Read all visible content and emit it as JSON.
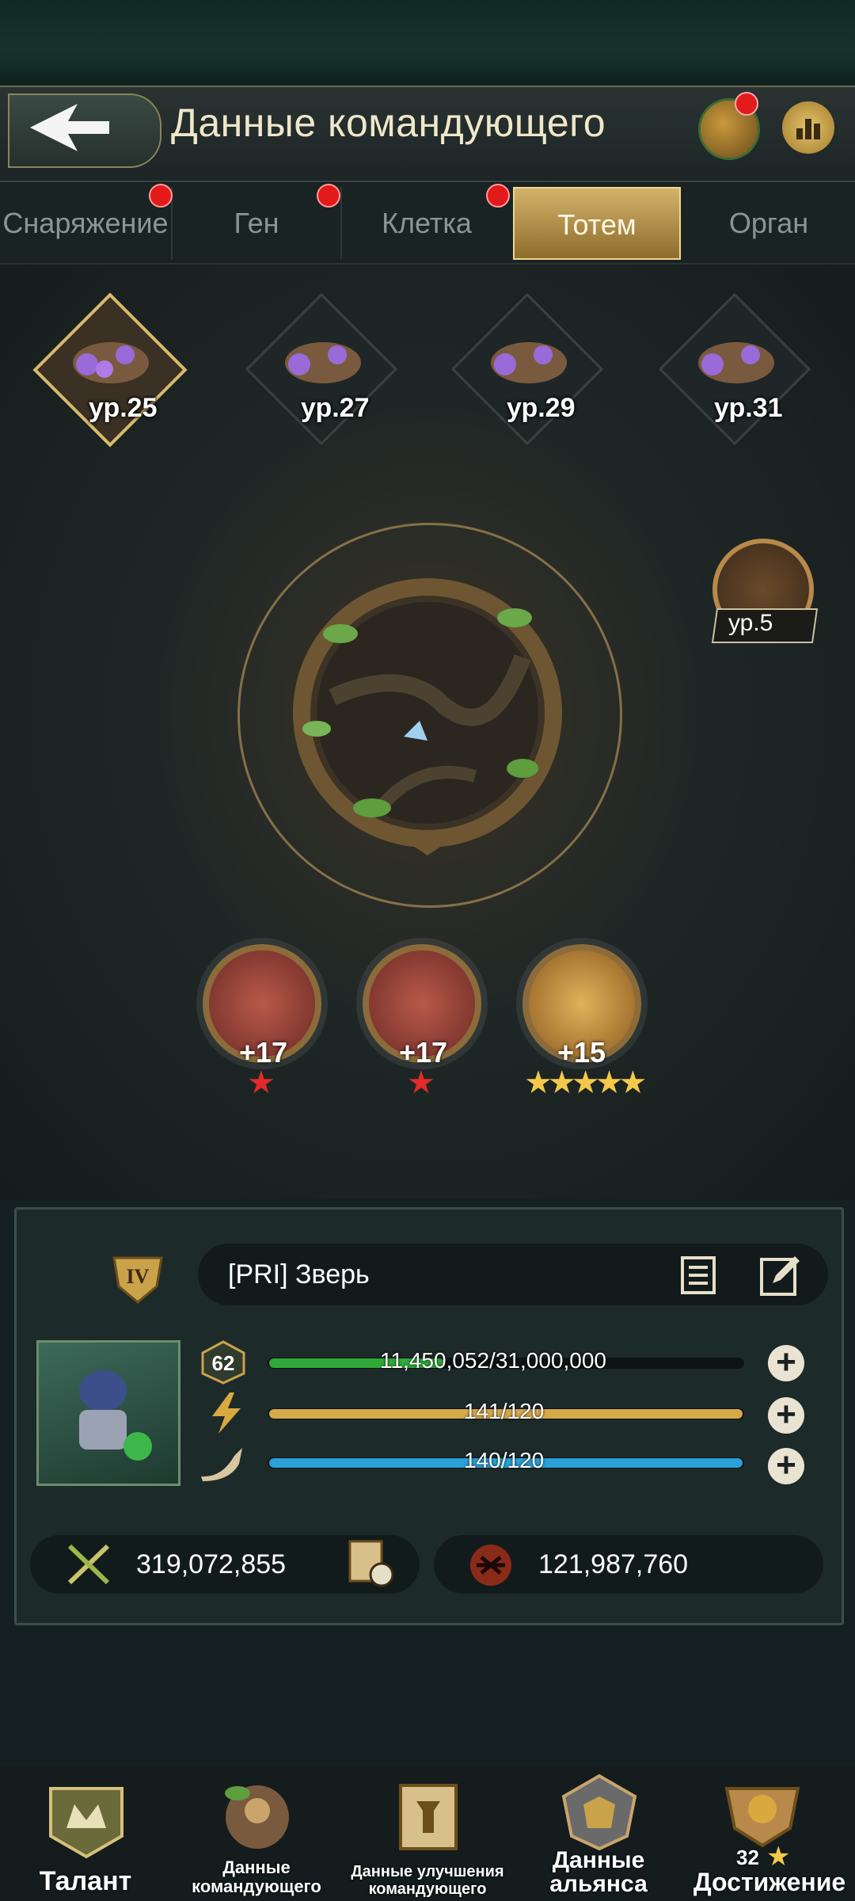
{
  "header": {
    "title": "Данные командующего",
    "back_label": "back"
  },
  "tabs": [
    {
      "label": "Снаряжение",
      "badge": true,
      "active": false
    },
    {
      "label": "Ген",
      "badge": true,
      "active": false
    },
    {
      "label": "Клетка",
      "badge": true,
      "active": false
    },
    {
      "label": "Тотем",
      "badge": false,
      "active": true
    },
    {
      "label": "Орган",
      "badge": false,
      "active": false
    }
  ],
  "totem_slots": [
    {
      "level": "ур.25",
      "selected": true
    },
    {
      "level": "ур.27",
      "selected": false
    },
    {
      "level": "ур.29",
      "selected": false
    },
    {
      "level": "ур.31",
      "selected": false
    }
  ],
  "side_emblem": {
    "level": "ур.5"
  },
  "medals": [
    {
      "value": "+17",
      "stars": 1,
      "star_color": "red"
    },
    {
      "value": "+17",
      "stars": 1,
      "star_color": "red"
    },
    {
      "value": "+15",
      "stars": 5,
      "star_color": "gold"
    }
  ],
  "profile": {
    "vip_level": "IV",
    "name": "[PRI]  Зверь",
    "level": "62",
    "stats": [
      {
        "icon": "level-badge-icon",
        "text": "11,450,052/31,000,000",
        "fill": 0.37,
        "color": "#2fa93a"
      },
      {
        "icon": "lightning-icon",
        "text": "141/120",
        "fill": 1.0,
        "color": "#d6a94a"
      },
      {
        "icon": "horn-icon",
        "text": "140/120",
        "fill": 1.0,
        "color": "#2a9fd8"
      }
    ],
    "power": "319,072,855",
    "kills": "121,987,760"
  },
  "nav": [
    {
      "label": "Талант",
      "icon": "talent-icon"
    },
    {
      "label": "Данные командующего",
      "icon": "commander-data-icon"
    },
    {
      "label": "Данные улучшения командующего",
      "icon": "upgrade-data-icon"
    },
    {
      "label": "Данные альянса",
      "icon": "alliance-data-icon"
    },
    {
      "label": "Достижение",
      "icon": "achievement-icon",
      "count": "32"
    }
  ]
}
